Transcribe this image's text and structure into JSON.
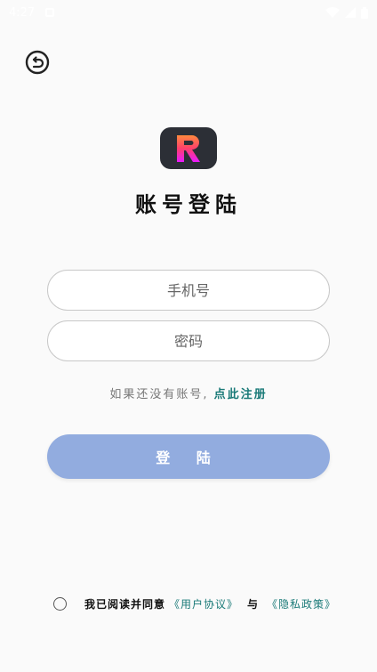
{
  "status_bar": {
    "time": "4:27"
  },
  "title": "账号登陆",
  "form": {
    "phone_placeholder": "手机号",
    "password_placeholder": "密码"
  },
  "register": {
    "prompt": "如果还没有账号,",
    "link": "点此注册"
  },
  "login_button_label": "登 陆",
  "agreement": {
    "prefix": "我已阅读并同意",
    "user_agreement": "《用户协议》",
    "conjunction": "与",
    "privacy_policy": "《隐私政策》"
  },
  "colors": {
    "background": "#fafafa",
    "accent": "#1a7a78",
    "button": "#92acdf",
    "logo_bg": "#2c2f36"
  }
}
